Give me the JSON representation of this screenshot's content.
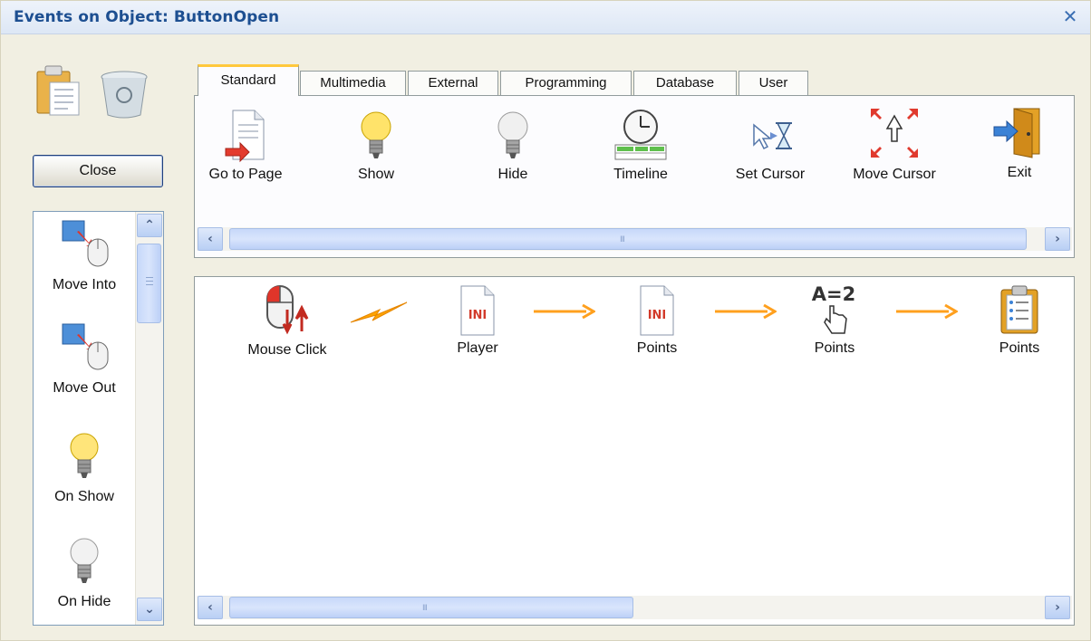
{
  "window": {
    "title": "Events on Object: ButtonOpen",
    "close_symbol": "✕"
  },
  "left": {
    "close_button": "Close",
    "events": [
      {
        "label": "Move Into",
        "icon": "move-into-icon"
      },
      {
        "label": "Move Out",
        "icon": "move-out-icon"
      },
      {
        "label": "On Show",
        "icon": "lightbulb-on-icon"
      },
      {
        "label": "On Hide",
        "icon": "lightbulb-off-icon"
      }
    ]
  },
  "tabs": [
    "Standard",
    "Multimedia",
    "External",
    "Programming",
    "Database",
    "User"
  ],
  "active_tab": "Standard",
  "palette": [
    {
      "label": "Go to Page",
      "icon": "page-arrow-icon"
    },
    {
      "label": "Show",
      "icon": "lightbulb-on-icon"
    },
    {
      "label": "Hide",
      "icon": "lightbulb-off-icon"
    },
    {
      "label": "Timeline",
      "icon": "timeline-clock-icon"
    },
    {
      "label": "Set Cursor",
      "icon": "cursor-hourglass-icon"
    },
    {
      "label": "Move Cursor",
      "icon": "move-cursor-icon"
    },
    {
      "label": "Exit",
      "icon": "exit-door-icon"
    }
  ],
  "flow": [
    {
      "label": "Mouse Click",
      "icon": "mouse-click-icon"
    },
    {
      "label": "Player",
      "icon": "ini-file-icon",
      "badge": "INI"
    },
    {
      "label": "Points",
      "icon": "ini-file-icon",
      "badge": "INI"
    },
    {
      "label": "Points",
      "icon": "assign-hand-icon",
      "badge": "A=2"
    },
    {
      "label": "Points",
      "icon": "clipboard-list-icon"
    }
  ],
  "colors": {
    "title": "#1d4f91",
    "accent_tab": "#ffc83c",
    "flow_arrow": "#ffa01e",
    "lightning": "#ffa500"
  }
}
